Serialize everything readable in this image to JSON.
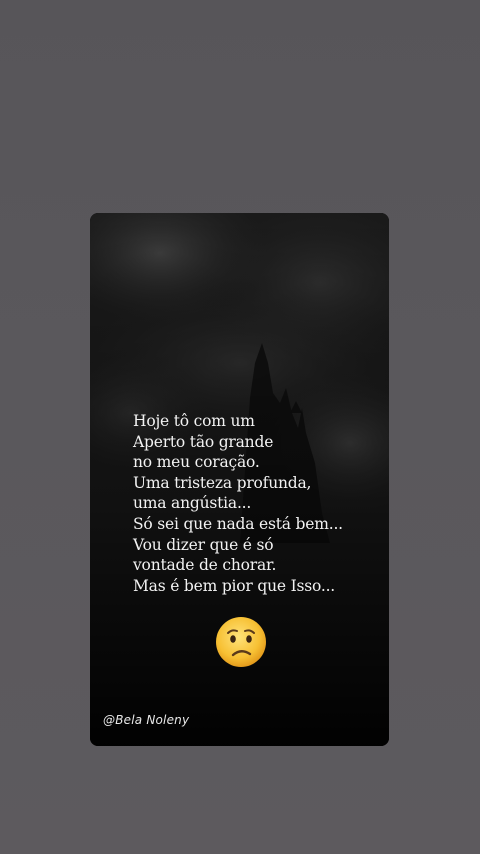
{
  "screen": {
    "background_color": "#58565a"
  },
  "post": {
    "background_color": "#080808",
    "poem_lines": [
      "Hoje tô com um",
      "Aperto tão grande",
      "no meu coração.",
      "Uma tristeza profunda,",
      "uma angústia...",
      "Só sei que nada está bem...",
      "Vou dizer que é só",
      "vontade de chorar.",
      "Mas é bem pior que Isso..."
    ],
    "emoji": "sad-face-icon",
    "signature": "@Bela Noleny"
  }
}
